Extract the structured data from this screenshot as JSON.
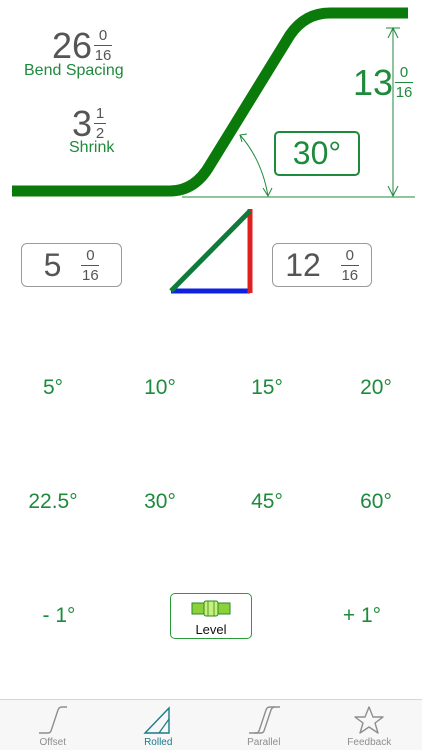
{
  "bend_spacing": {
    "whole": "26",
    "num": "0",
    "den": "16",
    "label": "Bend Spacing"
  },
  "shrink": {
    "whole": "3",
    "num": "1",
    "den": "2",
    "label": "Shrink"
  },
  "rise": {
    "whole": "13",
    "num": "0",
    "den": "16"
  },
  "angle": {
    "value": "30°"
  },
  "left_field": {
    "whole": "5",
    "num": "0",
    "den": "16"
  },
  "right_field": {
    "whole": "12",
    "num": "0",
    "den": "16"
  },
  "presets": {
    "row1": [
      "5°",
      "10°",
      "15°",
      "20°"
    ],
    "row2": [
      "22.5°",
      "30°",
      "45°",
      "60°"
    ]
  },
  "adjust": {
    "minus": "- 1°",
    "plus": "+ 1°",
    "level": "Level"
  },
  "tabs": [
    {
      "label": "Offset",
      "icon": "offset-icon",
      "active": false
    },
    {
      "label": "Rolled",
      "icon": "rolled-icon",
      "active": true
    },
    {
      "label": "Parallel",
      "icon": "parallel-icon",
      "active": false
    },
    {
      "label": "Feedback",
      "icon": "star-icon",
      "active": false
    }
  ],
  "colors": {
    "pipe": "#0a7a0a",
    "accent": "#1e8a3c",
    "active_tab": "#1a7a8a",
    "red": "#e02020",
    "blue": "#1020e0"
  }
}
